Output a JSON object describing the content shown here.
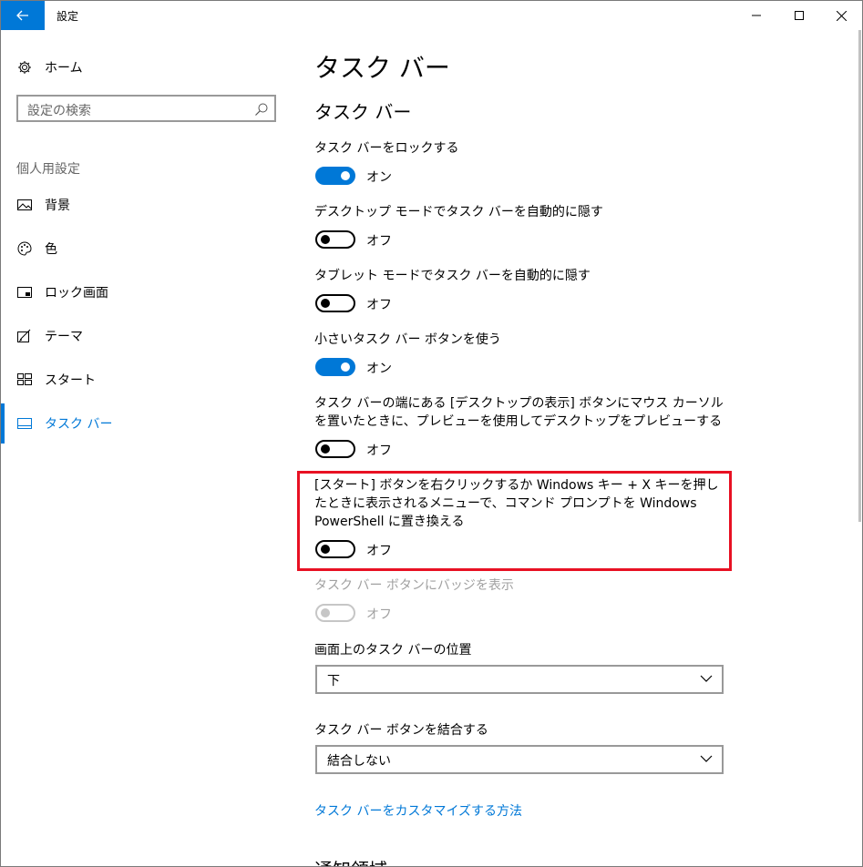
{
  "window": {
    "title": "設定"
  },
  "sidebar": {
    "home_label": "ホーム",
    "search_placeholder": "設定の検索",
    "section_label": "個人用設定",
    "items": [
      {
        "label": "背景",
        "icon": "picture-icon"
      },
      {
        "label": "色",
        "icon": "palette-icon"
      },
      {
        "label": "ロック画面",
        "icon": "lock-screen-icon"
      },
      {
        "label": "テーマ",
        "icon": "theme-icon"
      },
      {
        "label": "スタート",
        "icon": "start-icon"
      },
      {
        "label": "タスク バー",
        "icon": "taskbar-icon",
        "active": true
      }
    ]
  },
  "main": {
    "page_title": "タスク バー",
    "section_title": "タスク バー",
    "settings": [
      {
        "label": "タスク バーをロックする",
        "state": "オン",
        "on": true
      },
      {
        "label": "デスクトップ モードでタスク バーを自動的に隠す",
        "state": "オフ",
        "on": false
      },
      {
        "label": "タブレット モードでタスク バーを自動的に隠す",
        "state": "オフ",
        "on": false
      },
      {
        "label": "小さいタスク バー ボタンを使う",
        "state": "オン",
        "on": true
      },
      {
        "label": "タスク バーの端にある [デスクトップの表示] ボタンにマウス カーソルを置いたときに、プレビューを使用してデスクトップをプレビューする",
        "state": "オフ",
        "on": false
      },
      {
        "label": "[スタート] ボタンを右クリックするか Windows キー + X キーを押したときに表示されるメニューで、コマンド プロンプトを Windows PowerShell に置き換える",
        "state": "オフ",
        "on": false,
        "highlighted": true
      },
      {
        "label": "タスク バー ボタンにバッジを表示",
        "state": "オフ",
        "on": false,
        "disabled": true
      }
    ],
    "position_label": "画面上のタスク バーの位置",
    "position_value": "下",
    "combine_label": "タスク バー ボタンを結合する",
    "combine_value": "結合しない",
    "customize_link": "タスク バーをカスタマイズする方法",
    "next_section": "通知領域"
  },
  "colors": {
    "accent": "#0078d7",
    "highlight": "#e81123"
  }
}
